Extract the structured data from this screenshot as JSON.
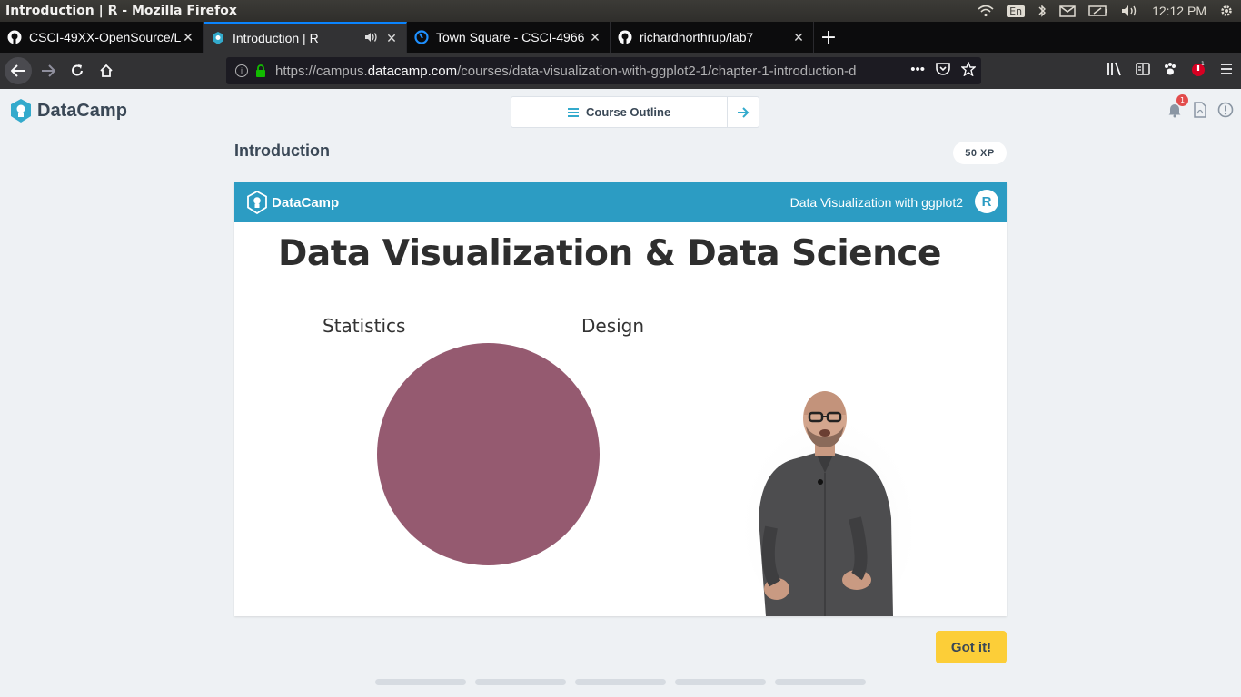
{
  "window": {
    "title": "Introduction | R - Mozilla Firefox"
  },
  "tray": {
    "lang": "En",
    "clock": "12:12 PM"
  },
  "tabs": [
    {
      "label": "CSCI-49XX-OpenSource/L",
      "icon": "github-icon"
    },
    {
      "label": "Introduction | R",
      "icon": "datacamp-icon",
      "active": true
    },
    {
      "label": "Town Square - CSCI-4966",
      "icon": "mattermost-icon"
    },
    {
      "label": "richardnorthrup/lab7",
      "icon": "github-icon"
    }
  ],
  "navbar": {
    "url_prefix": "https://campus.",
    "url_host": "datacamp.com",
    "url_path": "/courses/data-visualization-with-ggplot2-1/chapter-1-introduction-d"
  },
  "page": {
    "logo": "DataCamp",
    "course_outline": "Course Outline",
    "notification_count": "1",
    "exercise_title": "Introduction",
    "xp": "50 XP",
    "got_it": "Got it!",
    "progress_segments": 5
  },
  "video": {
    "header_logo": "DataCamp",
    "course_name": "Data Visualization with ggplot2",
    "r_logo": "R",
    "heading": "Data Visualization & Data Science",
    "label_left": "Statistics",
    "label_right": "Design",
    "circle_color": "#955a70"
  },
  "colors": {
    "accent": "#2c9cc3",
    "button": "#fcce38"
  }
}
